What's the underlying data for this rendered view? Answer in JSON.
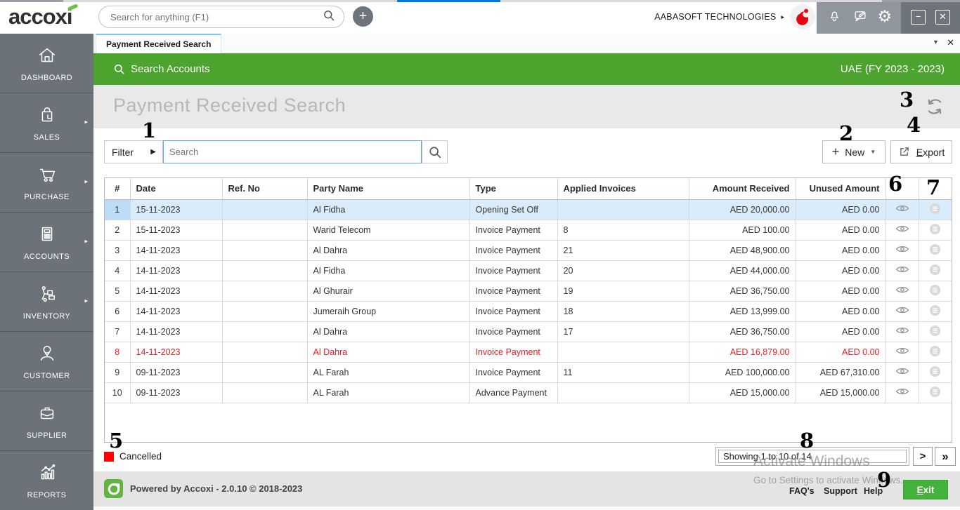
{
  "topbar": {
    "logo": "accoxi",
    "search_placeholder": "Search for anything (F1)",
    "plus_label": "+",
    "company": "AABASOFT TECHNOLOGIES",
    "minimize_label": "−",
    "close_label": "✕",
    "icons": [
      "bell-icon",
      "chat-icon",
      "gear-icon"
    ],
    "gear_glyph": "⚙"
  },
  "sidebar": {
    "items": [
      {
        "label": "DASHBOARD",
        "icon": "home"
      },
      {
        "label": "SALES",
        "icon": "shopping-bag"
      },
      {
        "label": "PURCHASE",
        "icon": "cart"
      },
      {
        "label": "ACCOUNTS",
        "icon": "calculator"
      },
      {
        "label": "INVENTORY",
        "icon": "hand-truck"
      },
      {
        "label": "CUSTOMER",
        "icon": "person"
      },
      {
        "label": "SUPPLIER",
        "icon": "briefcase"
      },
      {
        "label": "REPORTS",
        "icon": "bar-chart"
      }
    ],
    "submenu_arrow": "▸"
  },
  "tabs": {
    "active": "Payment Received Search",
    "caret": "▾",
    "close": "✕"
  },
  "context_bar": {
    "left": "Search Accounts",
    "right": "UAE (FY 2023 - 2023)"
  },
  "page": {
    "title": "Payment Received Search"
  },
  "toolbar": {
    "filter_label": "Filter",
    "filter_arrow": "▶",
    "search_placeholder": "Search",
    "new_plus": "+",
    "new_label": "New",
    "new_caret": "▼",
    "export_label": "Export"
  },
  "table": {
    "columns": [
      "#",
      "Date",
      "Ref. No",
      "Party Name",
      "Type",
      "Applied Invoices",
      "Amount Received",
      "Unused Amount"
    ],
    "rows": [
      {
        "no": "1",
        "date": "15-11-2023",
        "ref": "",
        "party": "Al Fidha",
        "type": "Opening Set Off",
        "applied": "",
        "received": "AED 20,000.00",
        "unused": "AED 0.00",
        "selected": true,
        "cancelled": false
      },
      {
        "no": "2",
        "date": "15-11-2023",
        "ref": "",
        "party": "Warid Telecom",
        "type": "Invoice Payment",
        "applied": "8",
        "received": "AED 100.00",
        "unused": "AED 0.00",
        "selected": false,
        "cancelled": false
      },
      {
        "no": "3",
        "date": "14-11-2023",
        "ref": "",
        "party": "Al Dahra",
        "type": "Invoice Payment",
        "applied": "21",
        "received": "AED 48,900.00",
        "unused": "AED 0.00",
        "selected": false,
        "cancelled": false
      },
      {
        "no": "4",
        "date": "14-11-2023",
        "ref": "",
        "party": "Al Fidha",
        "type": "Invoice Payment",
        "applied": "20",
        "received": "AED 44,000.00",
        "unused": "AED 0.00",
        "selected": false,
        "cancelled": false
      },
      {
        "no": "5",
        "date": "14-11-2023",
        "ref": "",
        "party": "Al Ghurair",
        "type": "Invoice Payment",
        "applied": "19",
        "received": "AED 36,750.00",
        "unused": "AED 0.00",
        "selected": false,
        "cancelled": false
      },
      {
        "no": "6",
        "date": "14-11-2023",
        "ref": "",
        "party": "Jumeraih Group",
        "type": "Invoice Payment",
        "applied": "18",
        "received": "AED 13,999.00",
        "unused": "AED 0.00",
        "selected": false,
        "cancelled": false
      },
      {
        "no": "7",
        "date": "14-11-2023",
        "ref": "",
        "party": "Al Dahra",
        "type": "Invoice Payment",
        "applied": "17",
        "received": "AED 36,750.00",
        "unused": "AED 0.00",
        "selected": false,
        "cancelled": false
      },
      {
        "no": "8",
        "date": "14-11-2023",
        "ref": "",
        "party": "Al Dahra",
        "type": "Invoice Payment",
        "applied": "",
        "received": "AED 16,879.00",
        "unused": "AED 0.00",
        "selected": false,
        "cancelled": true
      },
      {
        "no": "9",
        "date": "09-11-2023",
        "ref": "",
        "party": "AL Farah",
        "type": "Invoice Payment",
        "applied": "11",
        "received": "AED 100,000.00",
        "unused": "AED 67,310.00",
        "selected": false,
        "cancelled": false
      },
      {
        "no": "10",
        "date": "09-11-2023",
        "ref": "",
        "party": "AL Farah",
        "type": "Advance Payment",
        "applied": "",
        "received": "AED 15,000.00",
        "unused": "AED 15,000.00",
        "selected": false,
        "cancelled": false
      }
    ]
  },
  "legend": {
    "cancelled_label": "Cancelled",
    "cancelled_color": "#FF0000"
  },
  "pagination": {
    "summary": "Showing 1 to 10 of 14",
    "next": ">",
    "last": "»"
  },
  "footer": {
    "powered": "Powered by Accoxi - 2.0.10 © 2018-2023",
    "links": [
      "FAQ's",
      "Support",
      "Help"
    ],
    "exit_label": "Exit"
  },
  "watermark": {
    "line1": "Activate Windows",
    "line2": "Go to Settings to activate Windows."
  },
  "annotations": [
    "1",
    "2",
    "3",
    "4",
    "5",
    "6",
    "7",
    "8",
    "9"
  ],
  "colors": {
    "green_bar": "#4CA32E",
    "exit_green": "#44B13C",
    "sidebar_gray": "#6B7278",
    "selection_blue": "#D9ECFC",
    "cancelled_red": "#ED1C24",
    "input_border_blue": "#5BA7E0",
    "accent_blue_strip": "#0078D7"
  }
}
